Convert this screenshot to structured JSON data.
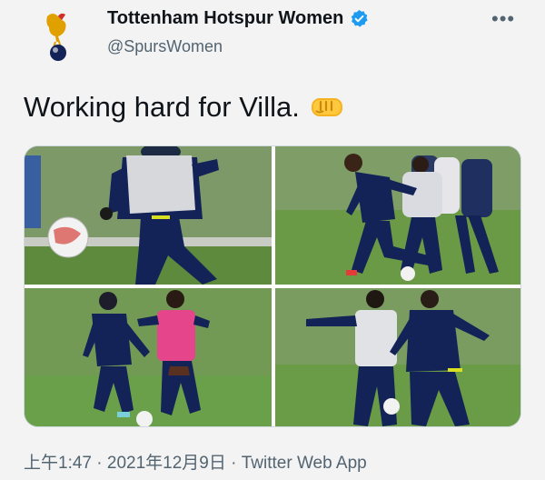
{
  "account": {
    "display_name": "Tottenham Hotspur Women",
    "handle": "@SpursWomen",
    "verified": true,
    "avatar_icon": "cockerel-crest-icon",
    "more_icon": "more-options-icon",
    "more_glyph": "•••"
  },
  "tweet": {
    "text": "Working hard for Villa.",
    "emoji_icon": "fist-emoji-icon"
  },
  "media": {
    "photos": [
      {
        "name": "training-photo-1"
      },
      {
        "name": "training-photo-2"
      },
      {
        "name": "training-photo-3"
      },
      {
        "name": "training-photo-4"
      }
    ]
  },
  "meta": {
    "time": "上午1:47",
    "separator1": " · ",
    "date": "2021年12月9日",
    "separator2": " · ",
    "source": "Twitter Web App"
  },
  "colors": {
    "navy": "#132257",
    "pitch_green": "#6b8f4a",
    "verified_blue": "#1d9bf0",
    "text_secondary": "#536471"
  }
}
